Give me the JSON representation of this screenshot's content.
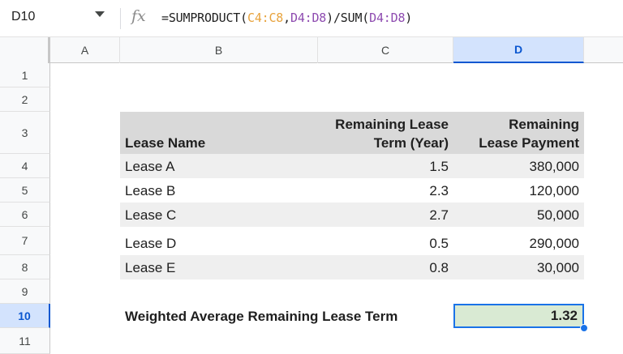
{
  "formula_bar": {
    "name_box": "D10",
    "fx_label": "fx",
    "formula_prefix": "=SUMPRODUCT(",
    "ref1": "C4:C8",
    "comma": ",",
    "ref2": "D4:D8",
    "mid": ")/SUM(",
    "ref3": "D4:D8",
    "suffix": ")"
  },
  "columns": [
    "A",
    "B",
    "C",
    "D"
  ],
  "rows": [
    "1",
    "2",
    "3",
    "4",
    "5",
    "6",
    "7",
    "8",
    "9",
    "10",
    "11"
  ],
  "table": {
    "headers": {
      "name": "Lease Name",
      "term_line1": "Remaining Lease",
      "term_line2": "Term (Year)",
      "payment_line1": "Remaining",
      "payment_line2": "Lease Payment"
    },
    "leases": [
      {
        "name": "Lease A",
        "term": "1.5",
        "payment": "380,000"
      },
      {
        "name": "Lease B",
        "term": "2.3",
        "payment": "120,000"
      },
      {
        "name": "Lease C",
        "term": "2.7",
        "payment": "50,000"
      },
      {
        "name": "Lease D",
        "term": "0.5",
        "payment": "290,000"
      },
      {
        "name": "Lease E",
        "term": "0.8",
        "payment": "30,000"
      }
    ]
  },
  "result": {
    "label": "Weighted Average Remaining Lease Term",
    "value": "1.32"
  },
  "colors": {
    "selection": "#1a73e8",
    "header_band": "#d9d9d9",
    "result_fill": "#d9ead3"
  }
}
